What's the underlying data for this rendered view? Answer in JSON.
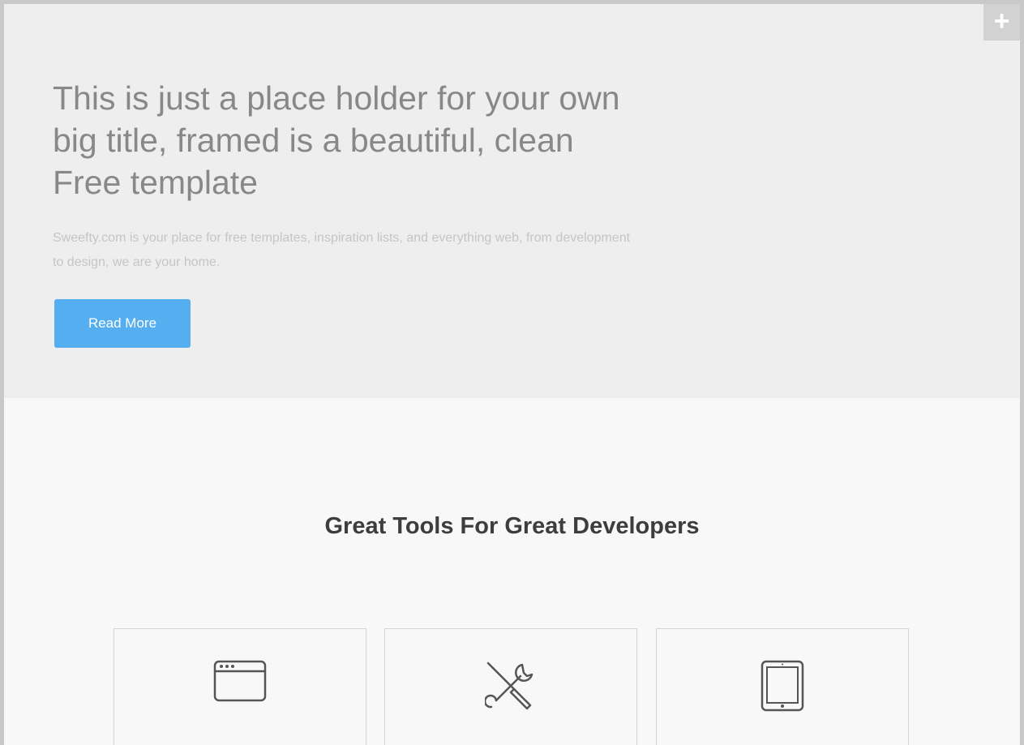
{
  "hero": {
    "menu_icon": "plus-icon",
    "title": "This is just a place holder for your own big title, framed is a beautiful, clean Free template",
    "text": "Sweefty.com is your place for free templates, inspiration lists, and everything web, from development to design, we are your home.",
    "button_label": "Read More",
    "button_color": "#55aeef"
  },
  "features": {
    "title": "Great Tools For Great Developers",
    "cards": [
      {
        "icon": "browser-window-icon"
      },
      {
        "icon": "wrench-screwdriver-icon"
      },
      {
        "icon": "tablet-icon"
      }
    ]
  }
}
